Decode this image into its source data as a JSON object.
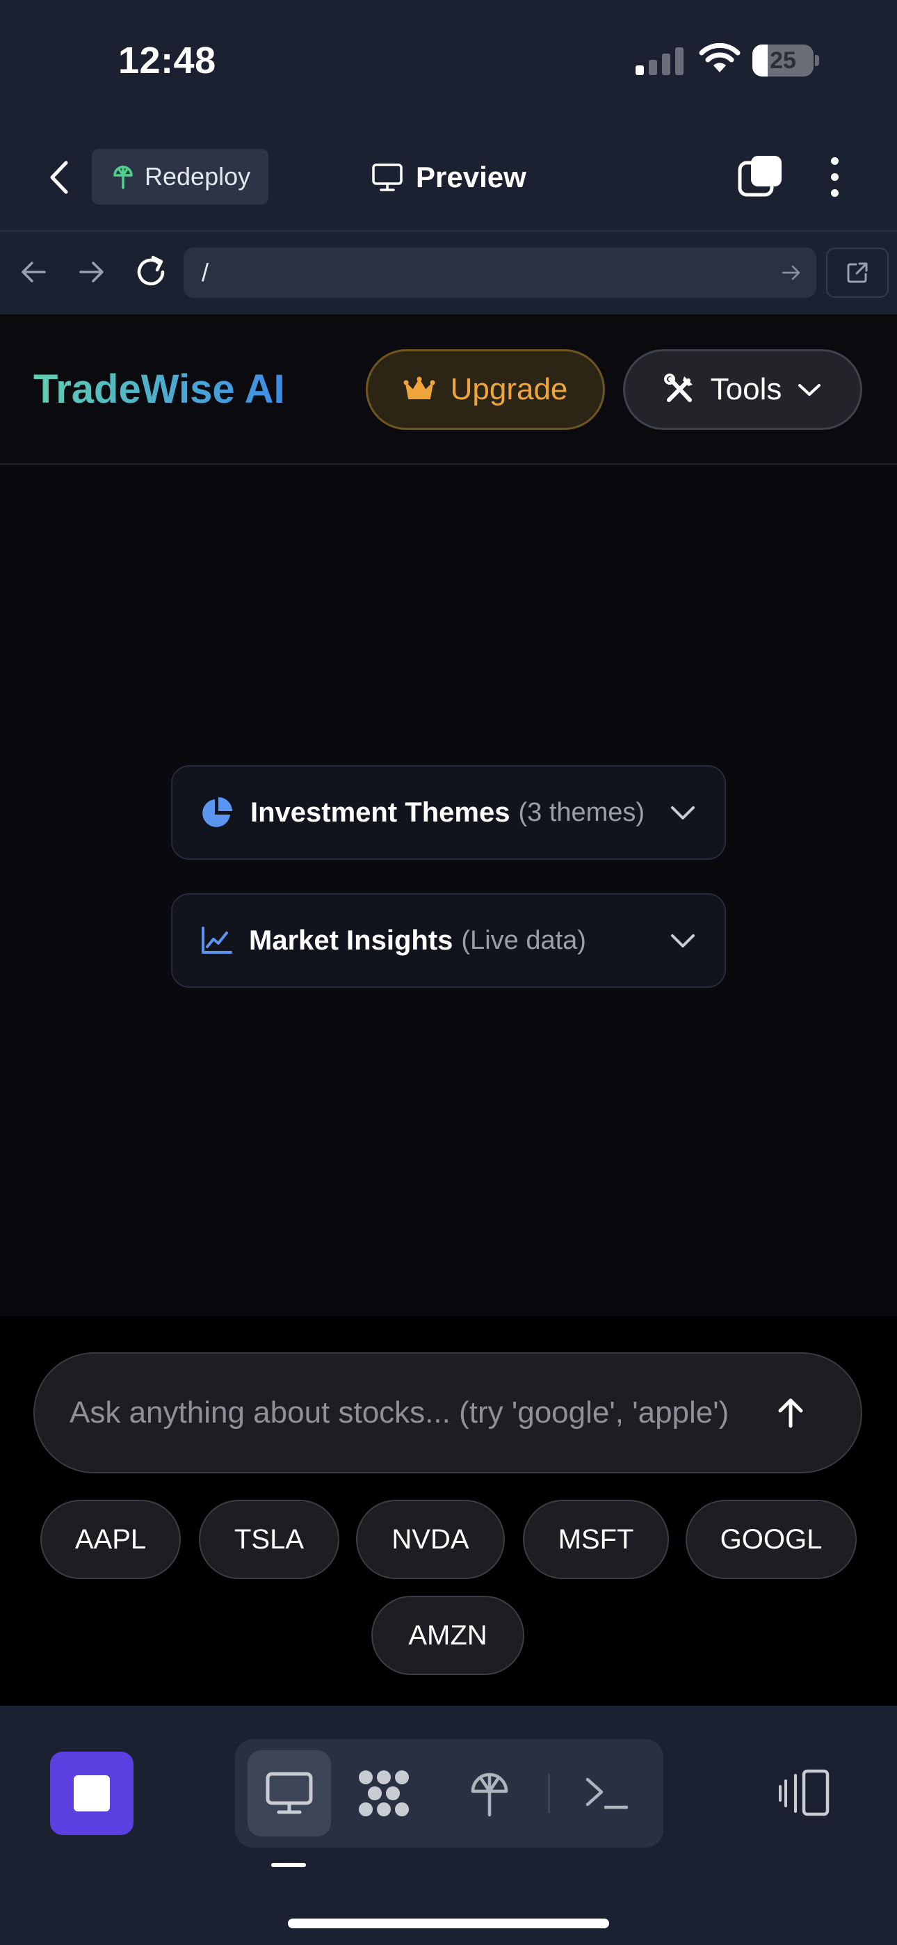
{
  "status_bar": {
    "time": "12:48",
    "battery_level": "25",
    "battery_fraction": 0.25
  },
  "browser_chrome": {
    "redeploy_label": "Redeploy",
    "preview_label": "Preview",
    "url": "/"
  },
  "app": {
    "brand": "TradeWise AI",
    "upgrade_label": "Upgrade",
    "tools_label": "Tools",
    "cards": [
      {
        "title": "Investment Themes",
        "subtitle": "(3 themes)",
        "icon": "pie-chart-icon"
      },
      {
        "title": "Market Insights",
        "subtitle": "(Live data)",
        "icon": "line-chart-icon"
      }
    ],
    "chat": {
      "placeholder": "Ask anything about stocks... (try 'google', 'apple')",
      "tickers": [
        "AAPL",
        "TSLA",
        "NVDA",
        "MSFT",
        "GOOGL",
        "AMZN"
      ]
    }
  },
  "toolbar": {
    "modes": [
      "desktop-preview-icon",
      "workflows-icon",
      "deploy-icon",
      "terminal-icon"
    ],
    "active_mode": "desktop-preview-icon"
  },
  "colors": {
    "chrome_bg": "#1b2131",
    "app_bg": "#0a0a0e",
    "accent_purple": "#5b3fe0",
    "upgrade_orange": "#f0a53a",
    "icon_blue": "#5b95f0",
    "brand_gradient_start": "#5fcfb0",
    "brand_gradient_end": "#3d8ce8"
  }
}
